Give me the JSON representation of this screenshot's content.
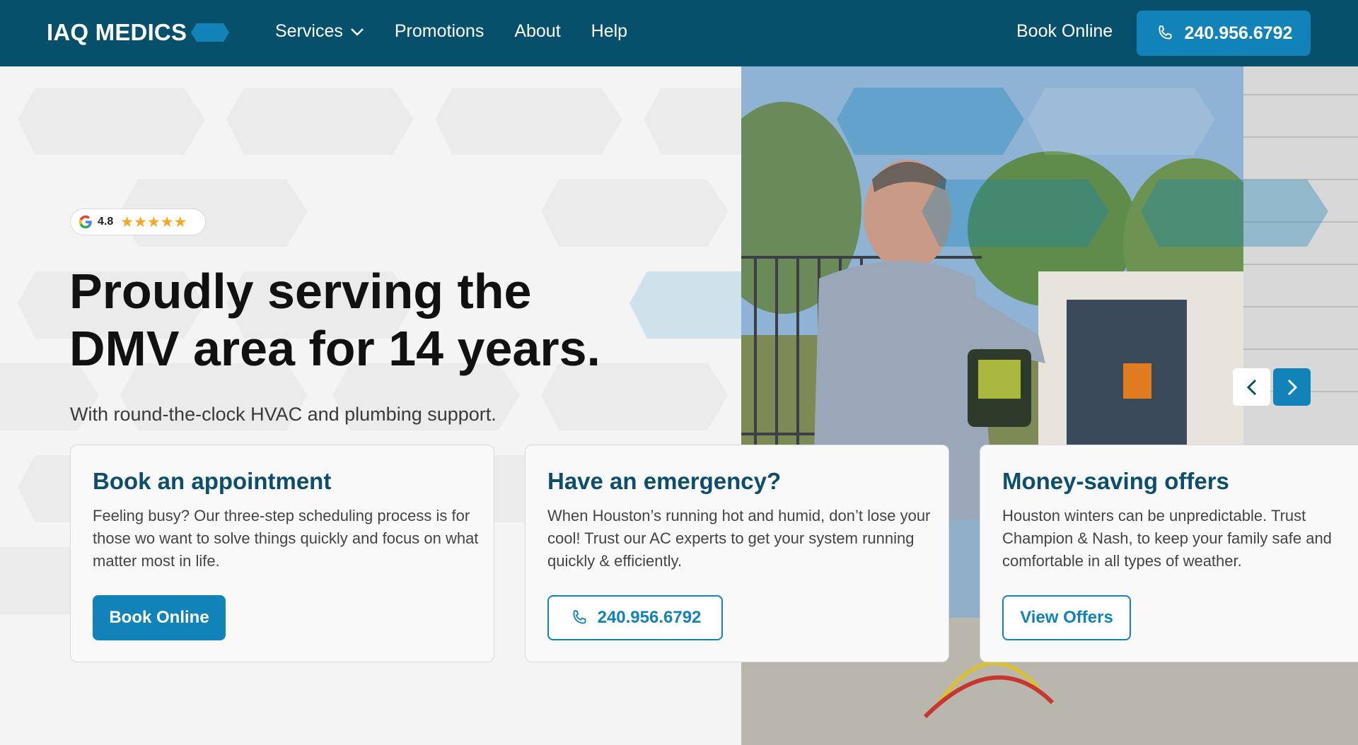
{
  "header": {
    "logo_text": "IAQ MEDICS",
    "nav": [
      {
        "label": "Services",
        "has_dropdown": true
      },
      {
        "label": "Promotions"
      },
      {
        "label": "About"
      },
      {
        "label": "Help"
      }
    ],
    "book_online": "Book Online",
    "phone": "240.956.6792"
  },
  "hero": {
    "rating_value": "4.8",
    "rating_stars": "★★★★★",
    "title": "Proudly serving the DMV area for 14 years.",
    "subtitle": "With round-the-clock HVAC and plumbing support."
  },
  "cards": [
    {
      "title": "Book an appointment",
      "body": "Feeling busy? Our three-step scheduling process is for those wo want to solve things quickly and focus on what matter most in life.",
      "button": "Book Online"
    },
    {
      "title": "Have an emergency?",
      "body": "When Houston’s running hot and humid, don’t lose your cool! Trust our AC experts to get your system running quickly & efficiently.",
      "button": "240.956.6792"
    },
    {
      "title": "Money-saving offers",
      "body_lines": [
        "Houston winters can be unpredictable. Trust",
        "Champion & Nash, to keep your family safe and",
        "comfortable in all types of weather."
      ],
      "button": "View Offers"
    }
  ],
  "colors": {
    "header_bg": "#06506b",
    "accent": "#1283b8",
    "card_title": "#0c4e6b"
  }
}
